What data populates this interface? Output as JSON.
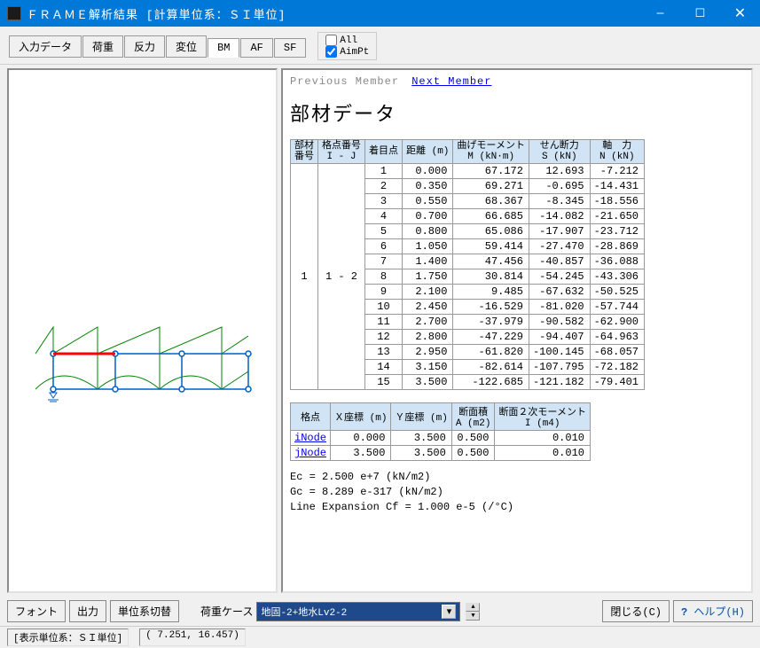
{
  "window": {
    "title": "ＦＲＡＭＥ解析結果  [計算単位系：ＳＩ単位]"
  },
  "tabs": [
    "入力データ",
    "荷重",
    "反力",
    "変位",
    "BM",
    "AF",
    "SF"
  ],
  "active_tab": 4,
  "checks": {
    "all": "All",
    "aimpt": "AimPt"
  },
  "nav": {
    "prev": "Previous Member",
    "next": "Next Member"
  },
  "heading": "部材データ",
  "table1": {
    "headers": [
      "部材\n番号",
      "格点番号\nI - J",
      "着目点",
      "距離 (m)",
      "曲げモーメント\nM (kN·m)",
      "せん断力\nS (kN)",
      "軸　力\nN (kN)"
    ],
    "member": "1",
    "ij": "1 - 2",
    "rows": [
      [
        "1",
        "0.000",
        "67.172",
        "12.693",
        "-7.212"
      ],
      [
        "2",
        "0.350",
        "69.271",
        "-0.695",
        "-14.431"
      ],
      [
        "3",
        "0.550",
        "68.367",
        "-8.345",
        "-18.556"
      ],
      [
        "4",
        "0.700",
        "66.685",
        "-14.082",
        "-21.650"
      ],
      [
        "5",
        "0.800",
        "65.086",
        "-17.907",
        "-23.712"
      ],
      [
        "6",
        "1.050",
        "59.414",
        "-27.470",
        "-28.869"
      ],
      [
        "7",
        "1.400",
        "47.456",
        "-40.857",
        "-36.088"
      ],
      [
        "8",
        "1.750",
        "30.814",
        "-54.245",
        "-43.306"
      ],
      [
        "9",
        "2.100",
        "9.485",
        "-67.632",
        "-50.525"
      ],
      [
        "10",
        "2.450",
        "-16.529",
        "-81.020",
        "-57.744"
      ],
      [
        "11",
        "2.700",
        "-37.979",
        "-90.582",
        "-62.900"
      ],
      [
        "12",
        "2.800",
        "-47.229",
        "-94.407",
        "-64.963"
      ],
      [
        "13",
        "2.950",
        "-61.820",
        "-100.145",
        "-68.057"
      ],
      [
        "14",
        "3.150",
        "-82.614",
        "-107.795",
        "-72.182"
      ],
      [
        "15",
        "3.500",
        "-122.685",
        "-121.182",
        "-79.401"
      ]
    ]
  },
  "table2": {
    "headers": [
      "格点",
      "Ｘ座標 (m)",
      "Ｙ座標 (m)",
      "断面積\nA (m2)",
      "断面２次モーメント\nI (m4)"
    ],
    "rows": [
      [
        "iNode",
        "0.000",
        "3.500",
        "0.500",
        "0.010"
      ],
      [
        "jNode",
        "3.500",
        "3.500",
        "0.500",
        "0.010"
      ]
    ]
  },
  "props": "Ec = 2.500 e+7 (kN/m2)\nGc = 8.289 e-317 (kN/m2)\nLine Expansion Cf = 1.000 e-5 (/°C)",
  "bottom": {
    "font": "フォント",
    "output": "出力",
    "unit": "単位系切替",
    "loadcase_label": "荷重ケース",
    "loadcase_value": "地固-2+地水Lv2-2",
    "close": "閉じる(C)",
    "help": "ヘルプ(H)"
  },
  "status": {
    "left": "[表示単位系：ＳＩ単位]",
    "coords": "( 7.251,  16.457)"
  }
}
